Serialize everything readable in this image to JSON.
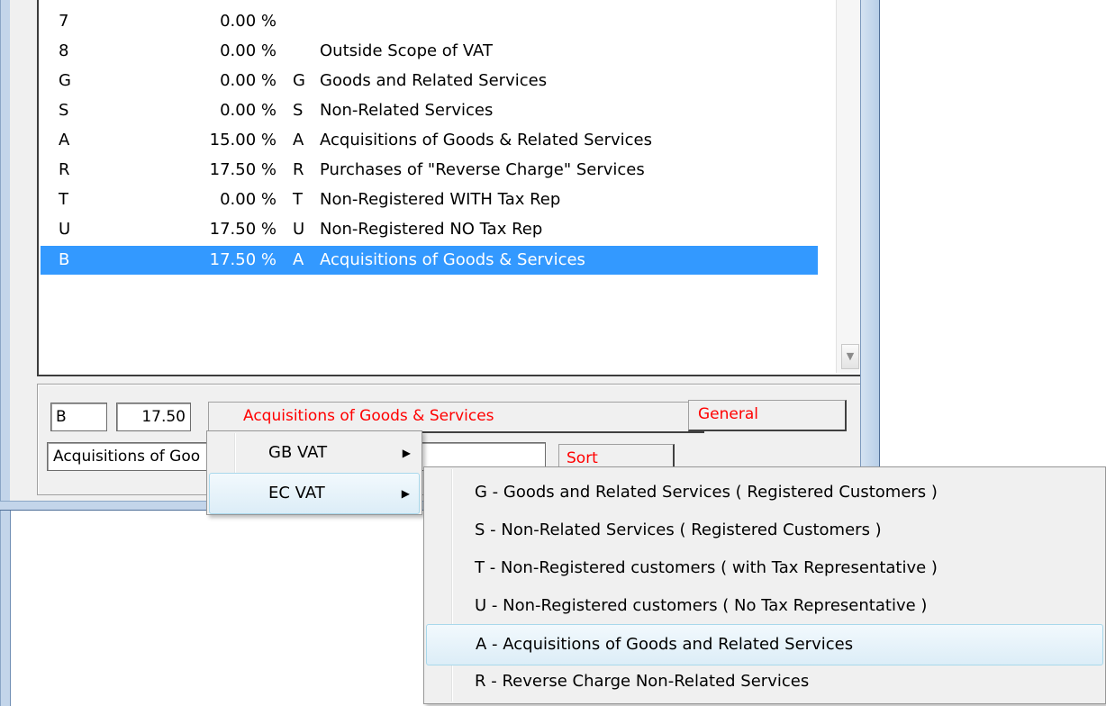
{
  "vat_list": {
    "rows": [
      {
        "code": "7",
        "rate": "0.00 %",
        "ec": "",
        "desc": ""
      },
      {
        "code": "8",
        "rate": "0.00 %",
        "ec": "",
        "desc": "Outside Scope of VAT"
      },
      {
        "code": "G",
        "rate": "0.00 %",
        "ec": "G",
        "desc": "Goods and Related Services"
      },
      {
        "code": "S",
        "rate": "0.00 %",
        "ec": "S",
        "desc": "Non-Related Services"
      },
      {
        "code": "A",
        "rate": "15.00 %",
        "ec": "A",
        "desc": "Acquisitions of Goods & Related Services"
      },
      {
        "code": "R",
        "rate": "17.50 %",
        "ec": "R",
        "desc": "Purchases of \"Reverse Charge\" Services"
      },
      {
        "code": "T",
        "rate": "0.00 %",
        "ec": "T",
        "desc": "Non-Registered WITH Tax Rep"
      },
      {
        "code": "U",
        "rate": "17.50 %",
        "ec": "U",
        "desc": "Non-Registered NO Tax Rep"
      },
      {
        "code": "B",
        "rate": "17.50 %",
        "ec": "A",
        "desc": "Acquisitions of Goods & Services"
      }
    ],
    "selected_index": 8,
    "scroll_down_glyph": "▼"
  },
  "editor": {
    "code_value": "B",
    "rate_value": "17.50",
    "description_value": "Acquisitions of Goods & Services",
    "type_value": "General",
    "long_desc_value": "Acquisitions of Goo",
    "extra_value": "",
    "sort_label": "Sort"
  },
  "context_menu": {
    "items": [
      {
        "label": "GB VAT",
        "arrow": "▶"
      },
      {
        "label": "EC VAT",
        "arrow": "▶"
      }
    ]
  },
  "ec_submenu": {
    "items": [
      "G - Goods and Related Services ( Registered Customers )",
      "S - Non-Related Services ( Registered Customers )",
      "T - Non-Registered customers ( with Tax Representative )",
      "U - Non-Registered customers ( No Tax Representative )",
      "A - Acquisitions of Goods and Related Services",
      "R - Reverse Charge Non-Related Services"
    ],
    "highlighted_index": 4
  }
}
